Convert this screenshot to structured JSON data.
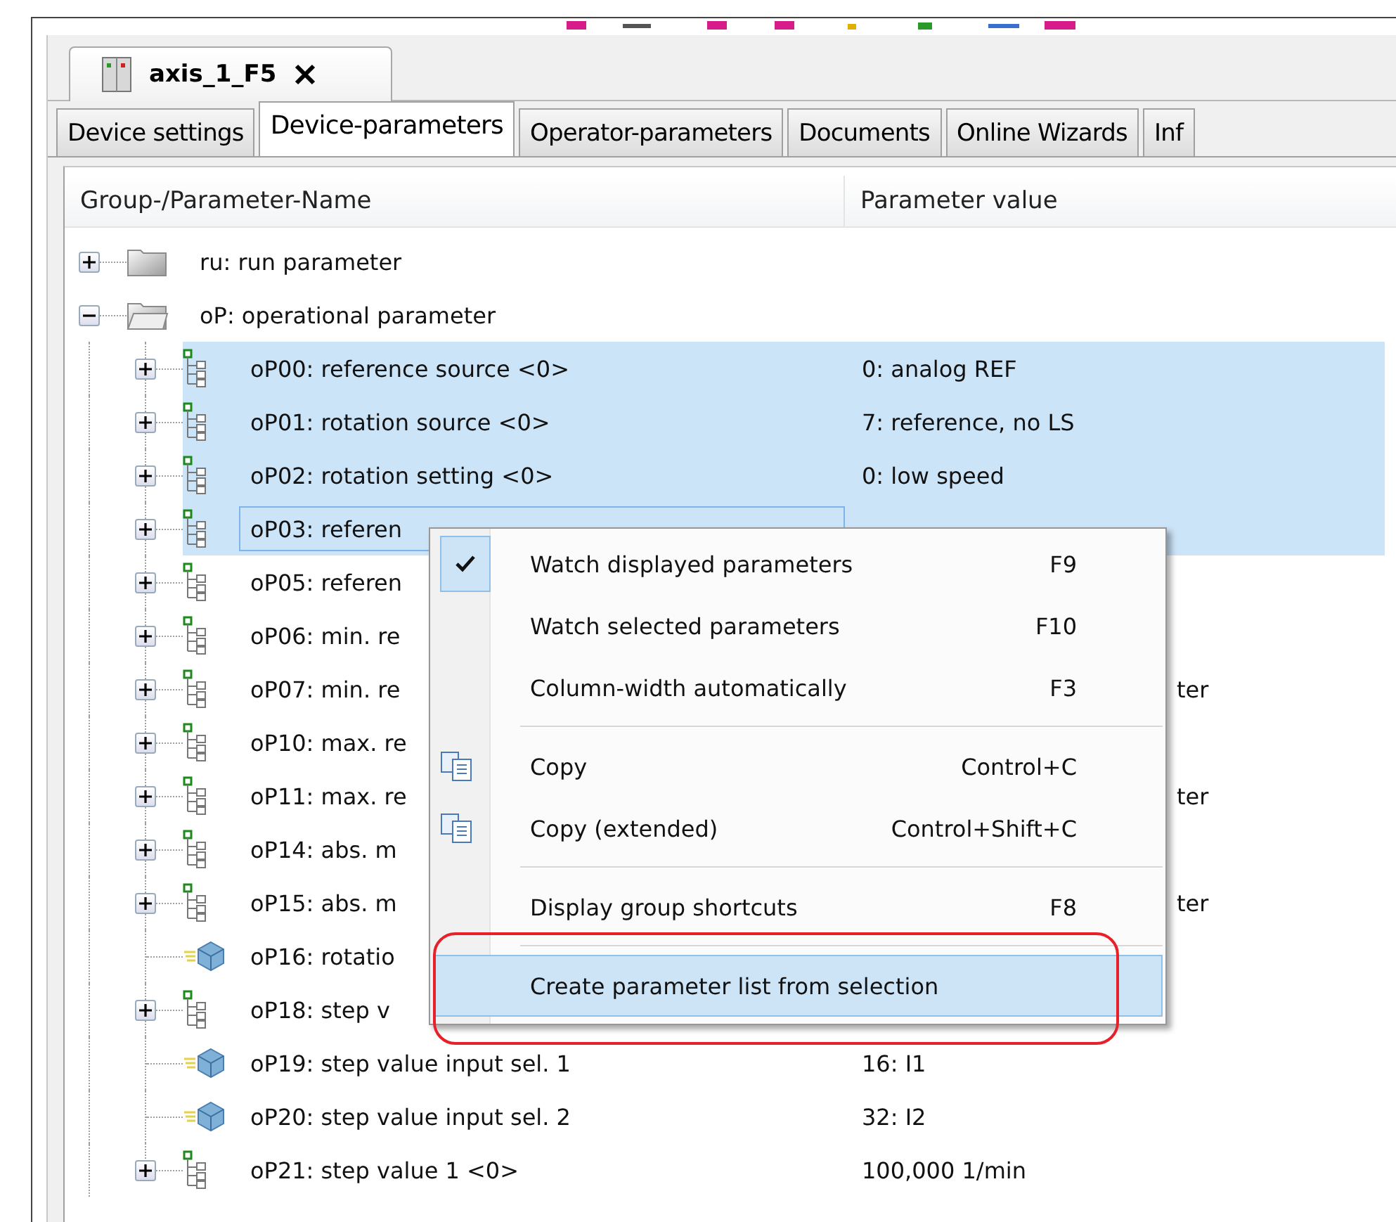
{
  "document_tab": {
    "title": "axis_1_F5"
  },
  "tabs": [
    {
      "label": "Device settings",
      "selected": false
    },
    {
      "label": "Device-parameters",
      "selected": true
    },
    {
      "label": "Operator-parameters",
      "selected": false
    },
    {
      "label": "Documents",
      "selected": false
    },
    {
      "label": "Online Wizards",
      "selected": false
    },
    {
      "label": "Inf",
      "selected": false
    }
  ],
  "tree": {
    "columns": [
      "Group-/Parameter-Name",
      "Parameter value"
    ],
    "items": [
      {
        "name": "ru: run parameter",
        "kind": "folder",
        "expanded": false
      },
      {
        "name": "oP: operational parameter",
        "kind": "folder",
        "expanded": true,
        "children": [
          {
            "name": "oP00: reference source <0>",
            "value": "0: analog REF",
            "kind": "group",
            "expanded": false,
            "selected": true,
            "focused": false
          },
          {
            "name": "oP01: rotation source <0>",
            "value": "7: reference, no LS",
            "kind": "group",
            "expanded": false,
            "selected": true,
            "focused": false
          },
          {
            "name": "oP02: rotation setting <0>",
            "value": "0: low speed",
            "kind": "group",
            "expanded": false,
            "selected": true,
            "focused": false
          },
          {
            "name": "oP03: referen",
            "kind": "group",
            "expanded": false,
            "selected": true,
            "focused": true
          },
          {
            "name": "oP05: referen",
            "kind": "group",
            "expanded": false,
            "selected": false,
            "focused": false
          },
          {
            "name": "oP06: min. re",
            "kind": "group",
            "expanded": false,
            "selected": false,
            "focused": false
          },
          {
            "name": "oP07: min. re",
            "value": "ter",
            "value_covered": true,
            "kind": "group",
            "expanded": false,
            "selected": false,
            "focused": false
          },
          {
            "name": "oP10: max. re",
            "kind": "group",
            "expanded": false,
            "selected": false,
            "focused": false
          },
          {
            "name": "oP11: max. re",
            "value": "ter",
            "value_covered": true,
            "kind": "group",
            "expanded": false,
            "selected": false,
            "focused": false
          },
          {
            "name": "oP14: abs. m",
            "kind": "group",
            "expanded": false,
            "selected": false,
            "focused": false
          },
          {
            "name": "oP15: abs. m",
            "value": "ter",
            "value_covered": true,
            "kind": "group",
            "expanded": false,
            "selected": false,
            "focused": false
          },
          {
            "name": "oP16: rotatio",
            "kind": "parameter",
            "selected": false,
            "focused": false
          },
          {
            "name": "oP18: step v",
            "kind": "group",
            "expanded": false,
            "selected": false,
            "focused": false
          },
          {
            "name": "oP19: step value input sel. 1",
            "value": "16: I1",
            "kind": "parameter",
            "selected": false,
            "focused": false
          },
          {
            "name": "oP20: step value input sel. 2",
            "value": "32: I2",
            "kind": "parameter",
            "selected": false,
            "focused": false
          },
          {
            "name": "oP21: step value 1 <0>",
            "value": "100,000 1/min",
            "kind": "group",
            "expanded": false,
            "selected": false,
            "focused": false
          }
        ]
      }
    ]
  },
  "context_menu": {
    "items": [
      {
        "kind": "command",
        "label": "Watch displayed parameters",
        "shortcut": "F9",
        "checked": true,
        "icon": false,
        "highlighted": false
      },
      {
        "kind": "command",
        "label": "Watch selected parameters",
        "shortcut": "F10",
        "checked": false,
        "icon": false,
        "highlighted": false
      },
      {
        "kind": "command",
        "label": "Column-width automatically",
        "shortcut": "F3",
        "checked": false,
        "icon": false,
        "highlighted": false
      },
      {
        "kind": "separator"
      },
      {
        "kind": "command",
        "label": "Copy",
        "shortcut": "Control+C",
        "checked": false,
        "icon": true,
        "highlighted": false
      },
      {
        "kind": "command",
        "label": "Copy (extended)",
        "shortcut": "Control+Shift+C",
        "checked": false,
        "icon": true,
        "highlighted": false
      },
      {
        "kind": "separator"
      },
      {
        "kind": "command",
        "label": "Display group shortcuts",
        "shortcut": "F8",
        "checked": false,
        "icon": false,
        "highlighted": false
      },
      {
        "kind": "separator"
      },
      {
        "kind": "command",
        "label": "Create parameter list from selection",
        "checked": false,
        "icon": false,
        "highlighted": true,
        "annotated": true
      }
    ]
  }
}
